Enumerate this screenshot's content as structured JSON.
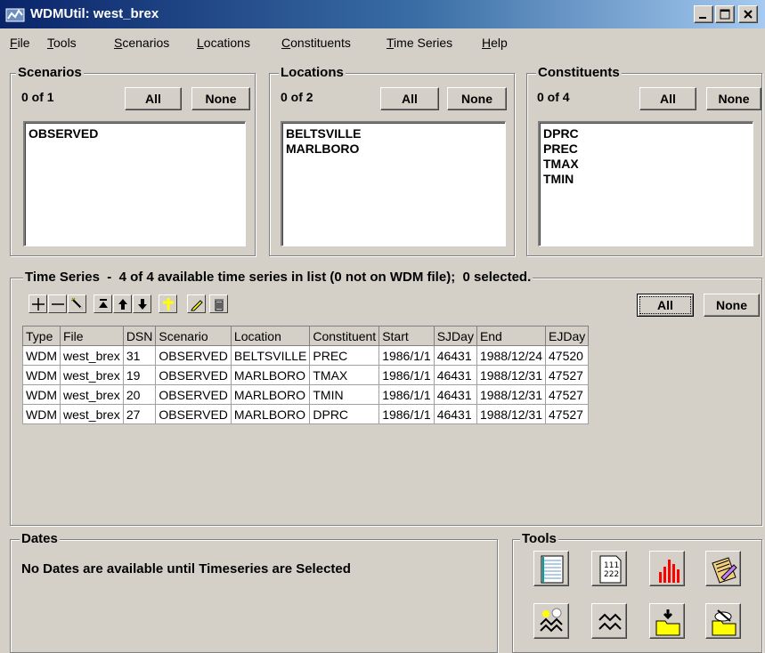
{
  "window": {
    "title": "WDMUtil: west_brex"
  },
  "menu": [
    {
      "label": "File",
      "u": "F",
      "rest": "ile"
    },
    {
      "label": "Tools",
      "u": "T",
      "rest": "ools"
    },
    {
      "label": "Scenarios",
      "u": "S",
      "rest": "cenarios"
    },
    {
      "label": "Locations",
      "u": "L",
      "rest": "ocations"
    },
    {
      "label": "Constituents",
      "u": "C",
      "rest": "onstituents"
    },
    {
      "label": "Time Series",
      "u": "T",
      "rest": "ime Series"
    },
    {
      "label": "Help",
      "u": "H",
      "rest": "elp"
    }
  ],
  "scenarios": {
    "title": "Scenarios",
    "count": "0 of 1",
    "all": "All",
    "none": "None",
    "items": [
      "OBSERVED"
    ]
  },
  "locations": {
    "title": "Locations",
    "count": "0 of 2",
    "all": "All",
    "none": "None",
    "items": [
      "BELTSVILLE",
      "MARLBORO"
    ]
  },
  "constituents": {
    "title": "Constituents",
    "count": "0 of 4",
    "all": "All",
    "none": "None",
    "items": [
      "DPRC",
      "PREC",
      "TMAX",
      "TMIN"
    ]
  },
  "timeseries": {
    "title": "Time Series  -  4 of 4 available time series in list (0 not on WDM file);  0 selected.",
    "all": "All",
    "none": "None",
    "toolbar_icons": [
      "add-icon",
      "remove-icon",
      "magic-wand-icon",
      "move-top-icon",
      "move-up-icon",
      "move-down-icon",
      "cross-icon",
      "pencil-icon",
      "trash-icon"
    ],
    "columns": [
      "Type",
      "File",
      "DSN",
      "Scenario",
      "Location",
      "Constituent",
      "Start",
      "SJDay",
      "End",
      "EJDay"
    ],
    "rows": [
      [
        "WDM",
        "west_brex",
        "31",
        "OBSERVED",
        "BELTSVILLE",
        "PREC",
        "1986/1/1",
        "46431",
        "1988/12/24",
        "47520"
      ],
      [
        "WDM",
        "west_brex",
        "19",
        "OBSERVED",
        "MARLBORO",
        "TMAX",
        "1986/1/1",
        "46431",
        "1988/12/31",
        "47527"
      ],
      [
        "WDM",
        "west_brex",
        "20",
        "OBSERVED",
        "MARLBORO",
        "TMIN",
        "1986/1/1",
        "46431",
        "1988/12/31",
        "47527"
      ],
      [
        "WDM",
        "west_brex",
        "27",
        "OBSERVED",
        "MARLBORO",
        "DPRC",
        "1986/1/1",
        "46431",
        "1988/12/31",
        "47527"
      ]
    ]
  },
  "dates": {
    "title": "Dates",
    "message": "No Dates are available until Timeseries are Selected"
  },
  "tools": {
    "title": "Tools",
    "icons": [
      "list-icon",
      "table-icon",
      "bar-chart-icon",
      "edit-icon",
      "generate-icon",
      "graph-icon",
      "import-icon",
      "export-icon"
    ],
    "table_icon_text": [
      "111",
      "222"
    ]
  },
  "colors": {
    "titlebar": "#0a246a",
    "face": "#d4d0c8",
    "highlight": "#ffff00",
    "chart": "#ff0000"
  }
}
